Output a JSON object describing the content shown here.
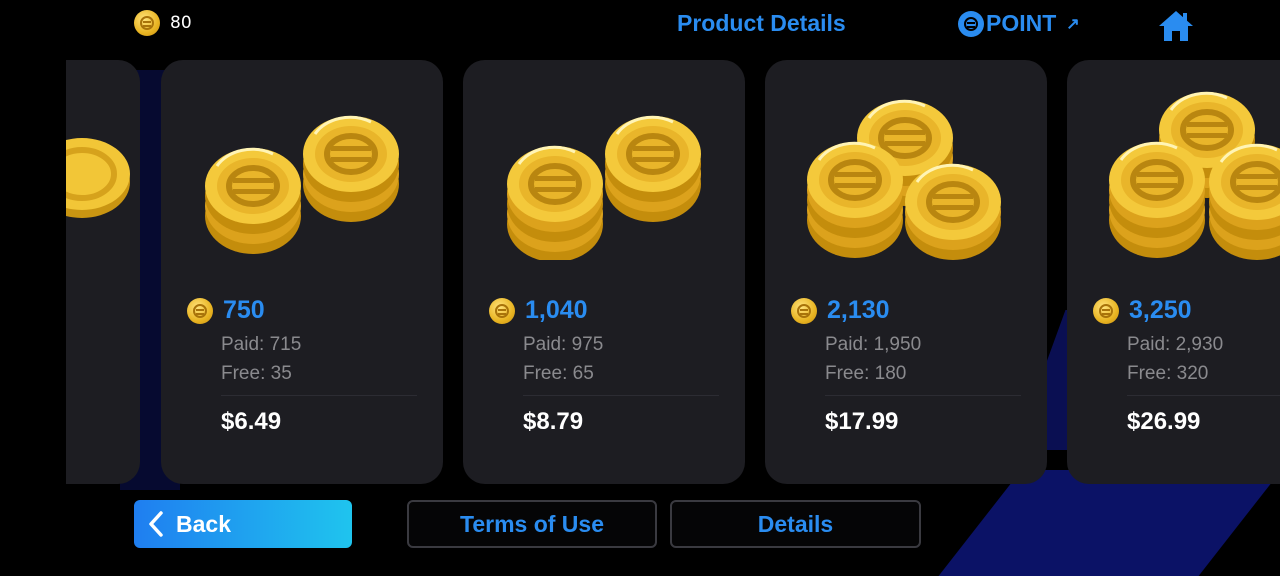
{
  "header": {
    "balance": "80",
    "balance_icon": "coin-icon",
    "product_details": "Product Details",
    "point_label": "POINT",
    "point_arrow": "↗",
    "home_icon": "home-icon"
  },
  "products": [
    {
      "amount": "750",
      "paid": "Paid: 715",
      "free": "Free: 35",
      "price": "$6.49"
    },
    {
      "amount": "1,040",
      "paid": "Paid: 975",
      "free": "Free: 65",
      "price": "$8.79"
    },
    {
      "amount": "2,130",
      "paid": "Paid: 1,950",
      "free": "Free: 180",
      "price": "$17.99"
    },
    {
      "amount": "3,250",
      "paid": "Paid: 2,930",
      "free": "Free: 320",
      "price": "$26.99"
    }
  ],
  "footer": {
    "back_label": "Back",
    "back_icon": "chevron-left-icon",
    "terms_label": "Terms of Use",
    "details_label": "Details"
  },
  "colors": {
    "accent": "#2a8cf0",
    "card": "#1d1d22",
    "coin": "#e8b422",
    "background": "#000000"
  }
}
